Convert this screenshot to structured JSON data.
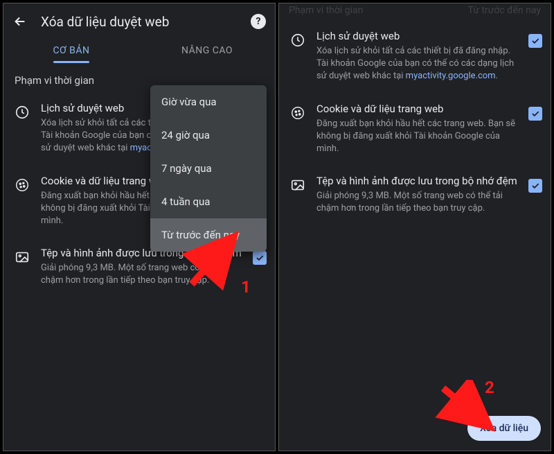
{
  "header": {
    "title": "Xóa dữ liệu duyệt web"
  },
  "tabs": {
    "basic": "CƠ BẢN",
    "advanced": "NÂNG CAO"
  },
  "time_range_label": "Phạm vi thời gian",
  "dropdown": {
    "opts": [
      "Giờ vừa qua",
      "24 giờ qua",
      "7 ngày qua",
      "4 tuần qua",
      "Từ trước đến nay"
    ]
  },
  "items": {
    "history": {
      "title": "Lịch sử duyệt web",
      "desc_left": "Xóa lịch sử khỏi tất cả các thiết bị đã đăng nhập. Tài khoản Google của bạn có thể có các dạng lịch sử duyệt web khác tại ",
      "desc_right": "Xóa lịch sử khỏi tất cả các thiết bị đã đăng nhập. Tài khoản Google của bạn có thể có các dạng lịch sử duyệt web khác tại ",
      "link": "myactivity.google.com"
    },
    "cookies": {
      "title_left": "Cookie và dữ liệu trang web",
      "title_right": "Cookie và dữ liệu trang web",
      "desc": "Đăng xuất bạn khỏi hầu hết các trang web. Bạn sẽ không bị đăng xuất khỏi Tài khoản Google của mình."
    },
    "cache": {
      "title": "Tệp và hình ảnh được lưu trong bộ nhớ đệm",
      "desc": "Giải phóng 9,3 MB. Một số trang web có thể tải chậm hơn trong lần tiếp theo bạn truy cập."
    }
  },
  "button": {
    "clear": "Xóa dữ liệu"
  },
  "right_header": {
    "left": "Phạm vi thời gian",
    "right": "Từ trước đến nay"
  },
  "annotations": {
    "step1": "1",
    "step2": "2"
  }
}
